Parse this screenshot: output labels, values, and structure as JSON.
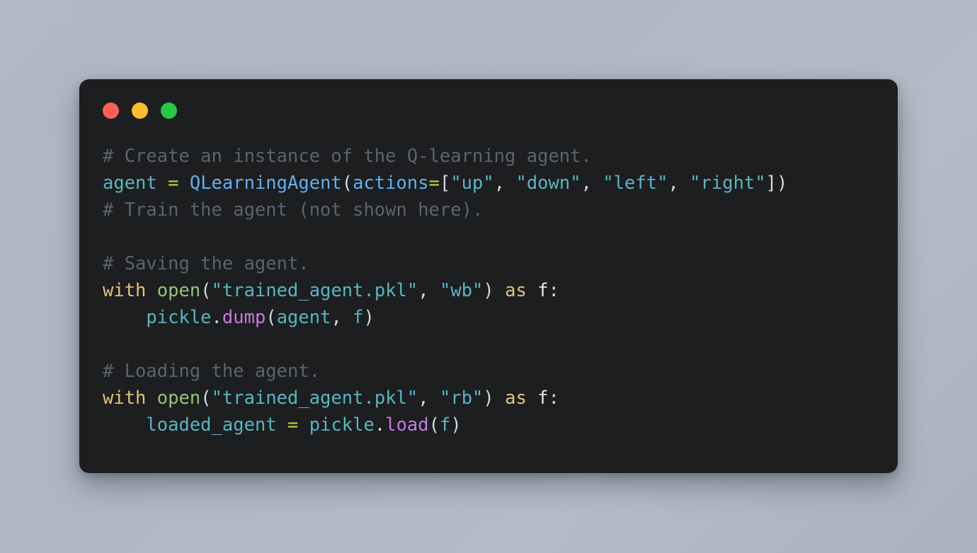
{
  "window": {
    "titlebar": {
      "close_label": "close",
      "minimize_label": "minimize",
      "maximize_label": "maximize"
    },
    "colors": {
      "background": "#1c1e20",
      "page_background": "#aeb7c3",
      "close": "#ff5f57",
      "minimize": "#febc2e",
      "maximize": "#28c840",
      "comment": "#5c6370",
      "variable": "#56b6c2",
      "operator": "#c3d82c",
      "class": "#61afef",
      "punctuation": "#d4d7da",
      "string": "#56b6c2",
      "keyword": "#e5c07b",
      "function": "#98c379",
      "method": "#c678dd",
      "plain": "#e6e6e6"
    }
  },
  "code": {
    "language": "python",
    "lines": [
      {
        "index": 1,
        "text": "# Create an instance of the Q-learning agent.",
        "tokens": [
          {
            "t": "# Create an instance of the Q-learning agent.",
            "c": "tok-comment"
          }
        ]
      },
      {
        "index": 2,
        "text": "agent = QLearningAgent(actions=[\"up\", \"down\", \"left\", \"right\"])",
        "tokens": [
          {
            "t": "agent",
            "c": "tok-var"
          },
          {
            "t": " ",
            "c": "tok-plain"
          },
          {
            "t": "=",
            "c": "tok-op"
          },
          {
            "t": " ",
            "c": "tok-plain"
          },
          {
            "t": "QLearningAgent",
            "c": "tok-class"
          },
          {
            "t": "(",
            "c": "tok-punct"
          },
          {
            "t": "actions",
            "c": "tok-kwarg"
          },
          {
            "t": "=",
            "c": "tok-op"
          },
          {
            "t": "[",
            "c": "tok-punct"
          },
          {
            "t": "\"up\"",
            "c": "tok-string"
          },
          {
            "t": ", ",
            "c": "tok-punct"
          },
          {
            "t": "\"down\"",
            "c": "tok-string"
          },
          {
            "t": ", ",
            "c": "tok-punct"
          },
          {
            "t": "\"left\"",
            "c": "tok-string"
          },
          {
            "t": ", ",
            "c": "tok-punct"
          },
          {
            "t": "\"right\"",
            "c": "tok-string"
          },
          {
            "t": "])",
            "c": "tok-punct"
          }
        ]
      },
      {
        "index": 3,
        "text": "# Train the agent (not shown here).",
        "tokens": [
          {
            "t": "# Train the agent (not shown here).",
            "c": "tok-comment"
          }
        ]
      },
      {
        "index": 4,
        "text": "",
        "tokens": []
      },
      {
        "index": 5,
        "text": "# Saving the agent.",
        "tokens": [
          {
            "t": "# Saving the agent.",
            "c": "tok-comment"
          }
        ]
      },
      {
        "index": 6,
        "text": "with open(\"trained_agent.pkl\", \"wb\") as f:",
        "tokens": [
          {
            "t": "with",
            "c": "tok-keyword"
          },
          {
            "t": " ",
            "c": "tok-plain"
          },
          {
            "t": "open",
            "c": "tok-func"
          },
          {
            "t": "(",
            "c": "tok-punct"
          },
          {
            "t": "\"trained_agent.pkl\"",
            "c": "tok-string"
          },
          {
            "t": ", ",
            "c": "tok-punct"
          },
          {
            "t": "\"wb\"",
            "c": "tok-string"
          },
          {
            "t": ")",
            "c": "tok-punct"
          },
          {
            "t": " ",
            "c": "tok-plain"
          },
          {
            "t": "as",
            "c": "tok-keyword"
          },
          {
            "t": " ",
            "c": "tok-plain"
          },
          {
            "t": "f",
            "c": "tok-plain"
          },
          {
            "t": ":",
            "c": "tok-punct"
          }
        ]
      },
      {
        "index": 7,
        "text": "    pickle.dump(agent, f)",
        "tokens": [
          {
            "t": "    ",
            "c": "tok-plain"
          },
          {
            "t": "pickle",
            "c": "tok-var"
          },
          {
            "t": ".",
            "c": "tok-punct"
          },
          {
            "t": "dump",
            "c": "tok-method"
          },
          {
            "t": "(",
            "c": "tok-punct"
          },
          {
            "t": "agent",
            "c": "tok-var"
          },
          {
            "t": ", ",
            "c": "tok-punct"
          },
          {
            "t": "f",
            "c": "tok-var"
          },
          {
            "t": ")",
            "c": "tok-punct"
          }
        ]
      },
      {
        "index": 8,
        "text": "",
        "tokens": []
      },
      {
        "index": 9,
        "text": "# Loading the agent.",
        "tokens": [
          {
            "t": "# Loading the agent.",
            "c": "tok-comment"
          }
        ]
      },
      {
        "index": 10,
        "text": "with open(\"trained_agent.pkl\", \"rb\") as f:",
        "tokens": [
          {
            "t": "with",
            "c": "tok-keyword"
          },
          {
            "t": " ",
            "c": "tok-plain"
          },
          {
            "t": "open",
            "c": "tok-func"
          },
          {
            "t": "(",
            "c": "tok-punct"
          },
          {
            "t": "\"trained_agent.pkl\"",
            "c": "tok-string"
          },
          {
            "t": ", ",
            "c": "tok-punct"
          },
          {
            "t": "\"rb\"",
            "c": "tok-string"
          },
          {
            "t": ")",
            "c": "tok-punct"
          },
          {
            "t": " ",
            "c": "tok-plain"
          },
          {
            "t": "as",
            "c": "tok-keyword"
          },
          {
            "t": " ",
            "c": "tok-plain"
          },
          {
            "t": "f",
            "c": "tok-plain"
          },
          {
            "t": ":",
            "c": "tok-punct"
          }
        ]
      },
      {
        "index": 11,
        "text": "    loaded_agent = pickle.load(f)",
        "tokens": [
          {
            "t": "    ",
            "c": "tok-plain"
          },
          {
            "t": "loaded_agent",
            "c": "tok-var"
          },
          {
            "t": " ",
            "c": "tok-plain"
          },
          {
            "t": "=",
            "c": "tok-op"
          },
          {
            "t": " ",
            "c": "tok-plain"
          },
          {
            "t": "pickle",
            "c": "tok-var"
          },
          {
            "t": ".",
            "c": "tok-punct"
          },
          {
            "t": "load",
            "c": "tok-method"
          },
          {
            "t": "(",
            "c": "tok-punct"
          },
          {
            "t": "f",
            "c": "tok-var"
          },
          {
            "t": ")",
            "c": "tok-punct"
          }
        ]
      }
    ]
  }
}
